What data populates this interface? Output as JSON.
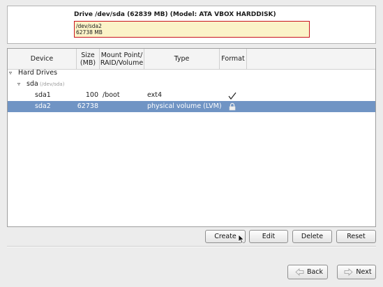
{
  "drive": {
    "title": "Drive /dev/sda (62839 MB) (Model: ATA VBOX HARDDISK)",
    "segment_name": "/dev/sda2",
    "segment_size": "62738 MB"
  },
  "columns": {
    "device": "Device",
    "size_line1": "Size",
    "size_line2": "(MB)",
    "mount_line1": "Mount Point/",
    "mount_line2": "RAID/Volume",
    "type": "Type",
    "format": "Format"
  },
  "tree": {
    "group_label": "Hard Drives",
    "disk_label": "sda",
    "disk_path": "(/dev/sda)",
    "rows": [
      {
        "device": "sda1",
        "size": "100",
        "mount": "/boot",
        "type": "ext4",
        "format": "checkmark"
      },
      {
        "device": "sda2",
        "size": "62738",
        "mount": "",
        "type": "physical volume (LVM)",
        "format": "lock"
      }
    ]
  },
  "actions": {
    "create": "Create",
    "edit": "Edit",
    "delete": "Delete",
    "reset": "Reset"
  },
  "navigation": {
    "back": "Back",
    "next": "Next"
  },
  "colors": {
    "selection": "#7094c4",
    "segment_fill": "#fbf3c8",
    "segment_border": "#c8141e"
  }
}
